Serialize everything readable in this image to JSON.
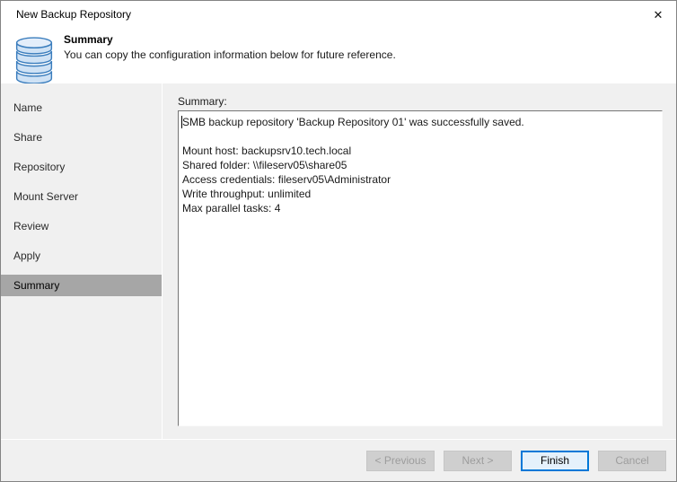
{
  "window": {
    "title": "New Backup Repository",
    "close_icon": "✕"
  },
  "header": {
    "title": "Summary",
    "description": "You can copy the configuration information below for future reference.",
    "icon": "database-stack-icon"
  },
  "sidebar": {
    "items": [
      {
        "label": "Name",
        "selected": false
      },
      {
        "label": "Share",
        "selected": false
      },
      {
        "label": "Repository",
        "selected": false
      },
      {
        "label": "Mount Server",
        "selected": false
      },
      {
        "label": "Review",
        "selected": false
      },
      {
        "label": "Apply",
        "selected": false
      },
      {
        "label": "Summary",
        "selected": true
      }
    ]
  },
  "main": {
    "label": "Summary:",
    "summary_lines": [
      "SMB backup repository 'Backup Repository 01' was successfully saved.",
      "",
      "Mount host: backupsrv10.tech.local",
      "Shared folder: \\\\fileserv05\\share05",
      "Access credentials: fileserv05\\Administrator",
      "Write throughput: unlimited",
      "Max parallel tasks: 4"
    ]
  },
  "footer": {
    "buttons": [
      {
        "label": "< Previous",
        "enabled": false
      },
      {
        "label": "Next >",
        "enabled": false
      },
      {
        "label": "Finish",
        "enabled": true,
        "default": true
      },
      {
        "label": "Cancel",
        "enabled": false
      }
    ]
  },
  "colors": {
    "window_bg": "#f0f0f0",
    "header_bg": "#ffffff",
    "selected_step_bg": "#a6a6a6",
    "accent_blue": "#0078d7",
    "default_button_bg": "#e5f1fb",
    "disabled_button_bg": "#cfcfcf",
    "disabled_button_text": "#9d9d9d",
    "icon_stroke_blue": "#3a7dbd",
    "icon_fill_blue": "#cfe2f5"
  }
}
